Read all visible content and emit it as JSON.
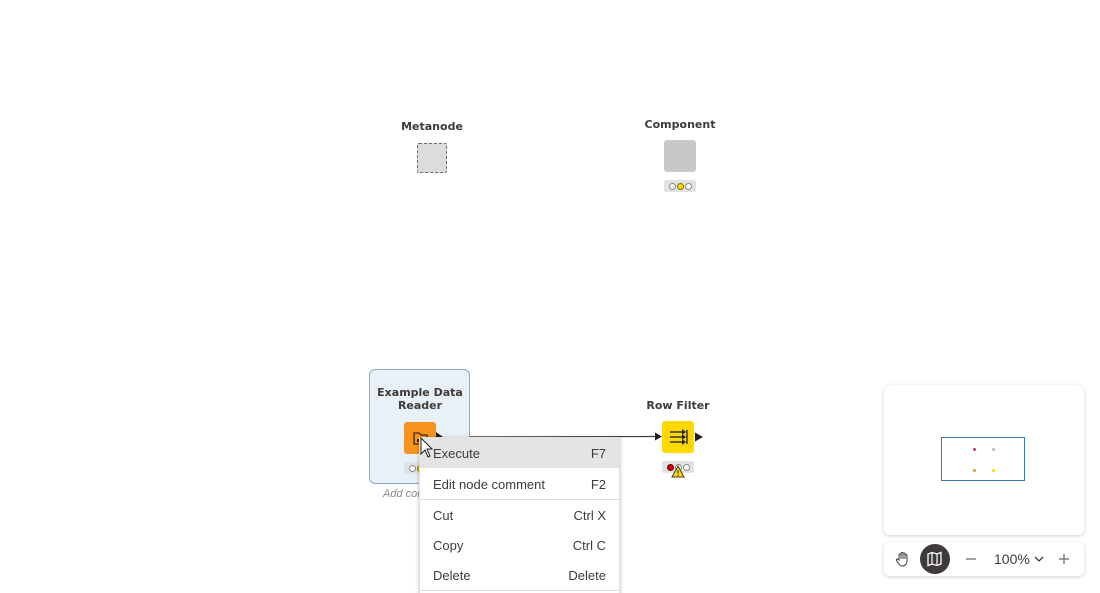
{
  "nodes": {
    "metanode": {
      "title": "Metanode"
    },
    "component": {
      "title": "Component"
    },
    "example_reader": {
      "title_line1": "Example Data",
      "title_line2": "Reader",
      "comment": "Add comment"
    },
    "row_filter": {
      "title": "Row Filter"
    }
  },
  "context_menu": {
    "items": [
      {
        "label": "Execute",
        "shortcut": "F7"
      },
      {
        "label": "Edit node comment",
        "shortcut": "F2"
      },
      {
        "label": "Cut",
        "shortcut": "Ctrl X"
      },
      {
        "label": "Copy",
        "shortcut": "Ctrl C"
      },
      {
        "label": "Delete",
        "shortcut": "Delete"
      }
    ]
  },
  "toolbar": {
    "zoom": "100%"
  },
  "colors": {
    "reader": "#f7941d",
    "filter": "#ffd800",
    "selection": "#e8f0f8",
    "minimap_frame": "#3a74b0"
  }
}
